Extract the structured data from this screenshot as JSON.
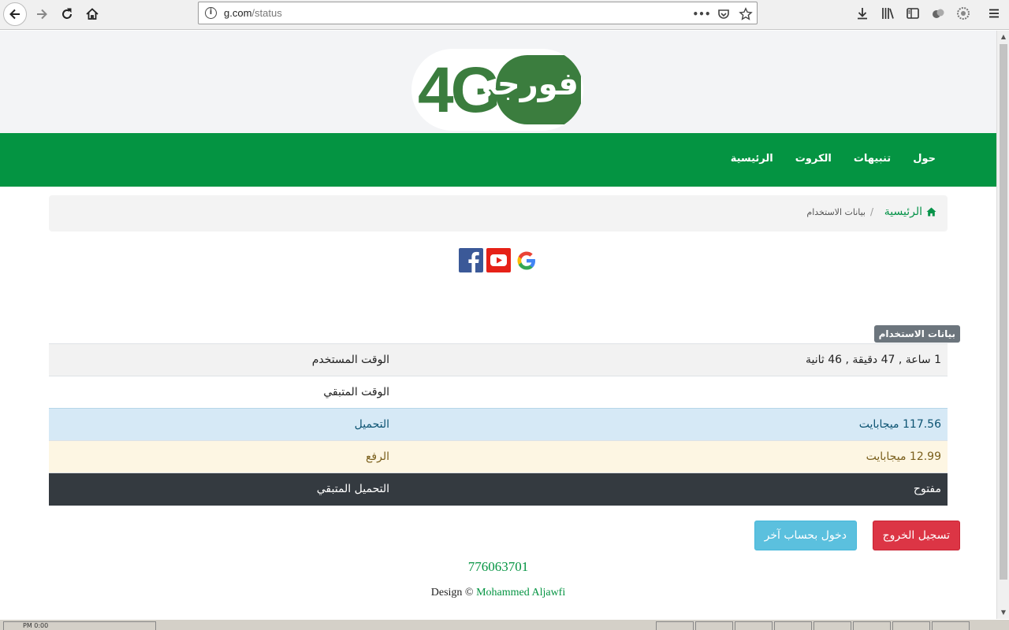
{
  "browser": {
    "url_host": "g.com",
    "url_path": "/status",
    "ellipsis": "•••"
  },
  "logo": {
    "text_latin": "4G",
    "text_arabic": "فورجي"
  },
  "navbar": {
    "items": [
      "حول",
      "تنبيهات",
      "الكروت",
      "الرئيسية"
    ]
  },
  "breadcrumb": {
    "home": "الرئيسية",
    "separator": "/",
    "current": "بيانات الاستخدام"
  },
  "usage": {
    "badge": "بيانات الاستخدام",
    "rows": [
      {
        "label": "الوقت المستخدم",
        "value": "1 ساعة , 47 دقيقة , 46 ثانية"
      },
      {
        "label": "الوقت المتبقي",
        "value": ""
      },
      {
        "label": "التحميل",
        "value": "117.56 ميجابايت"
      },
      {
        "label": "الرفع",
        "value": "12.99 ميجابايت"
      },
      {
        "label": "التحميل المتبقي",
        "value": "مفتوح"
      }
    ]
  },
  "buttons": {
    "logout": "تسجيل الخروج",
    "other_account": "دخول بحساب آخر"
  },
  "footer": {
    "phone": "776063701",
    "credit_prefix": "Design ©",
    "author": "Mohammed Aljawfi"
  },
  "taskbar": {
    "clock": "PM 0:00"
  },
  "colors": {
    "brand_green": "#049442",
    "logo_green": "#3b7d3e",
    "danger": "#dc3545",
    "info": "#5bc0de",
    "dark": "#343a40"
  }
}
